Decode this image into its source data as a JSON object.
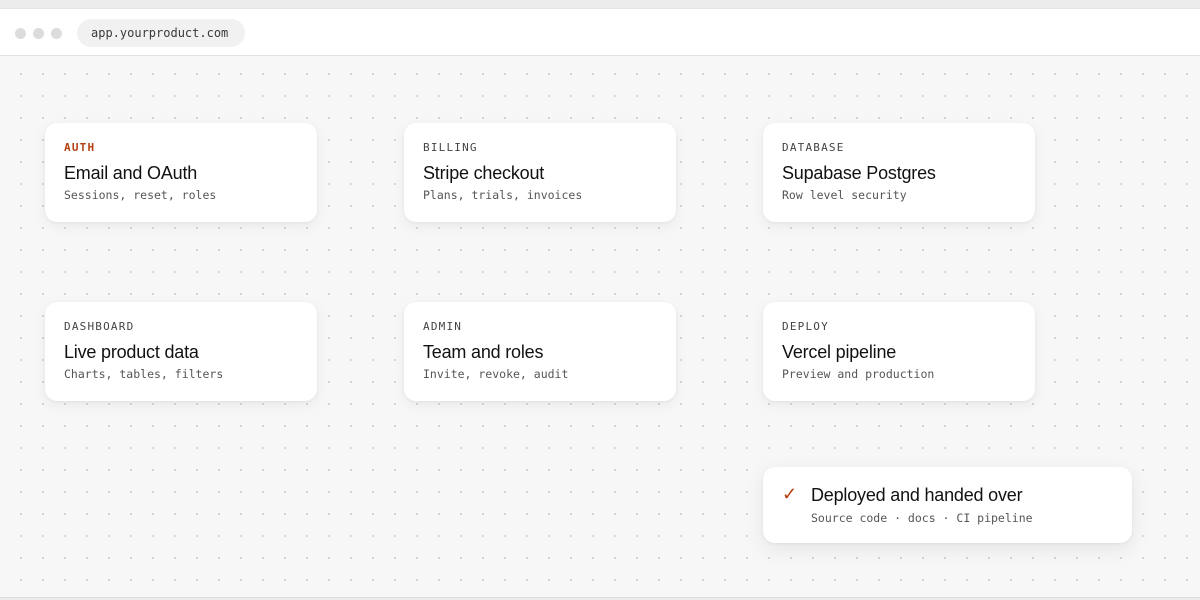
{
  "browser": {
    "url": "app.yourproduct.com"
  },
  "cards": [
    {
      "tag": "AUTH",
      "title": "Email and OAuth",
      "subtitle": "Sessions, reset, roles",
      "highlighted": true
    },
    {
      "tag": "BILLING",
      "title": "Stripe checkout",
      "subtitle": "Plans, trials, invoices"
    },
    {
      "tag": "DATABASE",
      "title": "Supabase Postgres",
      "subtitle": "Row level security"
    },
    {
      "tag": "DASHBOARD",
      "title": "Live product data",
      "subtitle": "Charts, tables, filters"
    },
    {
      "tag": "ADMIN",
      "title": "Team and roles",
      "subtitle": "Invite, revoke, audit"
    },
    {
      "tag": "DEPLOY",
      "title": "Vercel pipeline",
      "subtitle": "Preview and production"
    }
  ],
  "status": {
    "icon": "checkmark-icon",
    "check_glyph": "✓",
    "title": "Deployed and handed over",
    "subtitle": "Source code · docs · CI pipeline"
  },
  "colors": {
    "accent": "#b4400f",
    "canvas": "#f7f7f7",
    "card": "#ffffff"
  }
}
